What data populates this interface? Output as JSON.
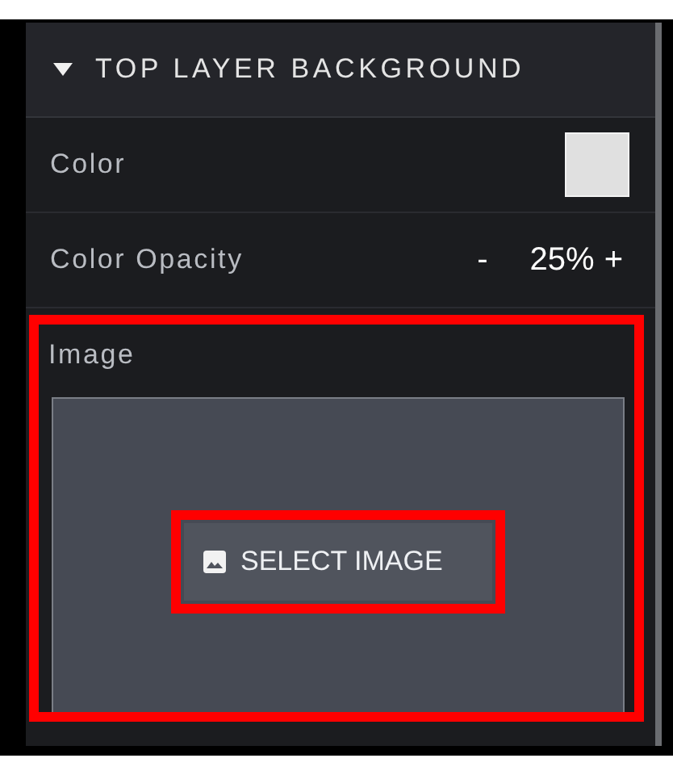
{
  "section": {
    "title": "TOP LAYER BACKGROUND",
    "expanded": true
  },
  "color_row": {
    "label": "Color",
    "color": "#e0e0e0"
  },
  "opacity_row": {
    "label": "Color Opacity",
    "decrement": "-",
    "value": "25%",
    "increment": "+"
  },
  "image_row": {
    "label": "Image",
    "highlighted": true,
    "button": {
      "label": "SELECT IMAGE",
      "highlighted": true
    }
  }
}
